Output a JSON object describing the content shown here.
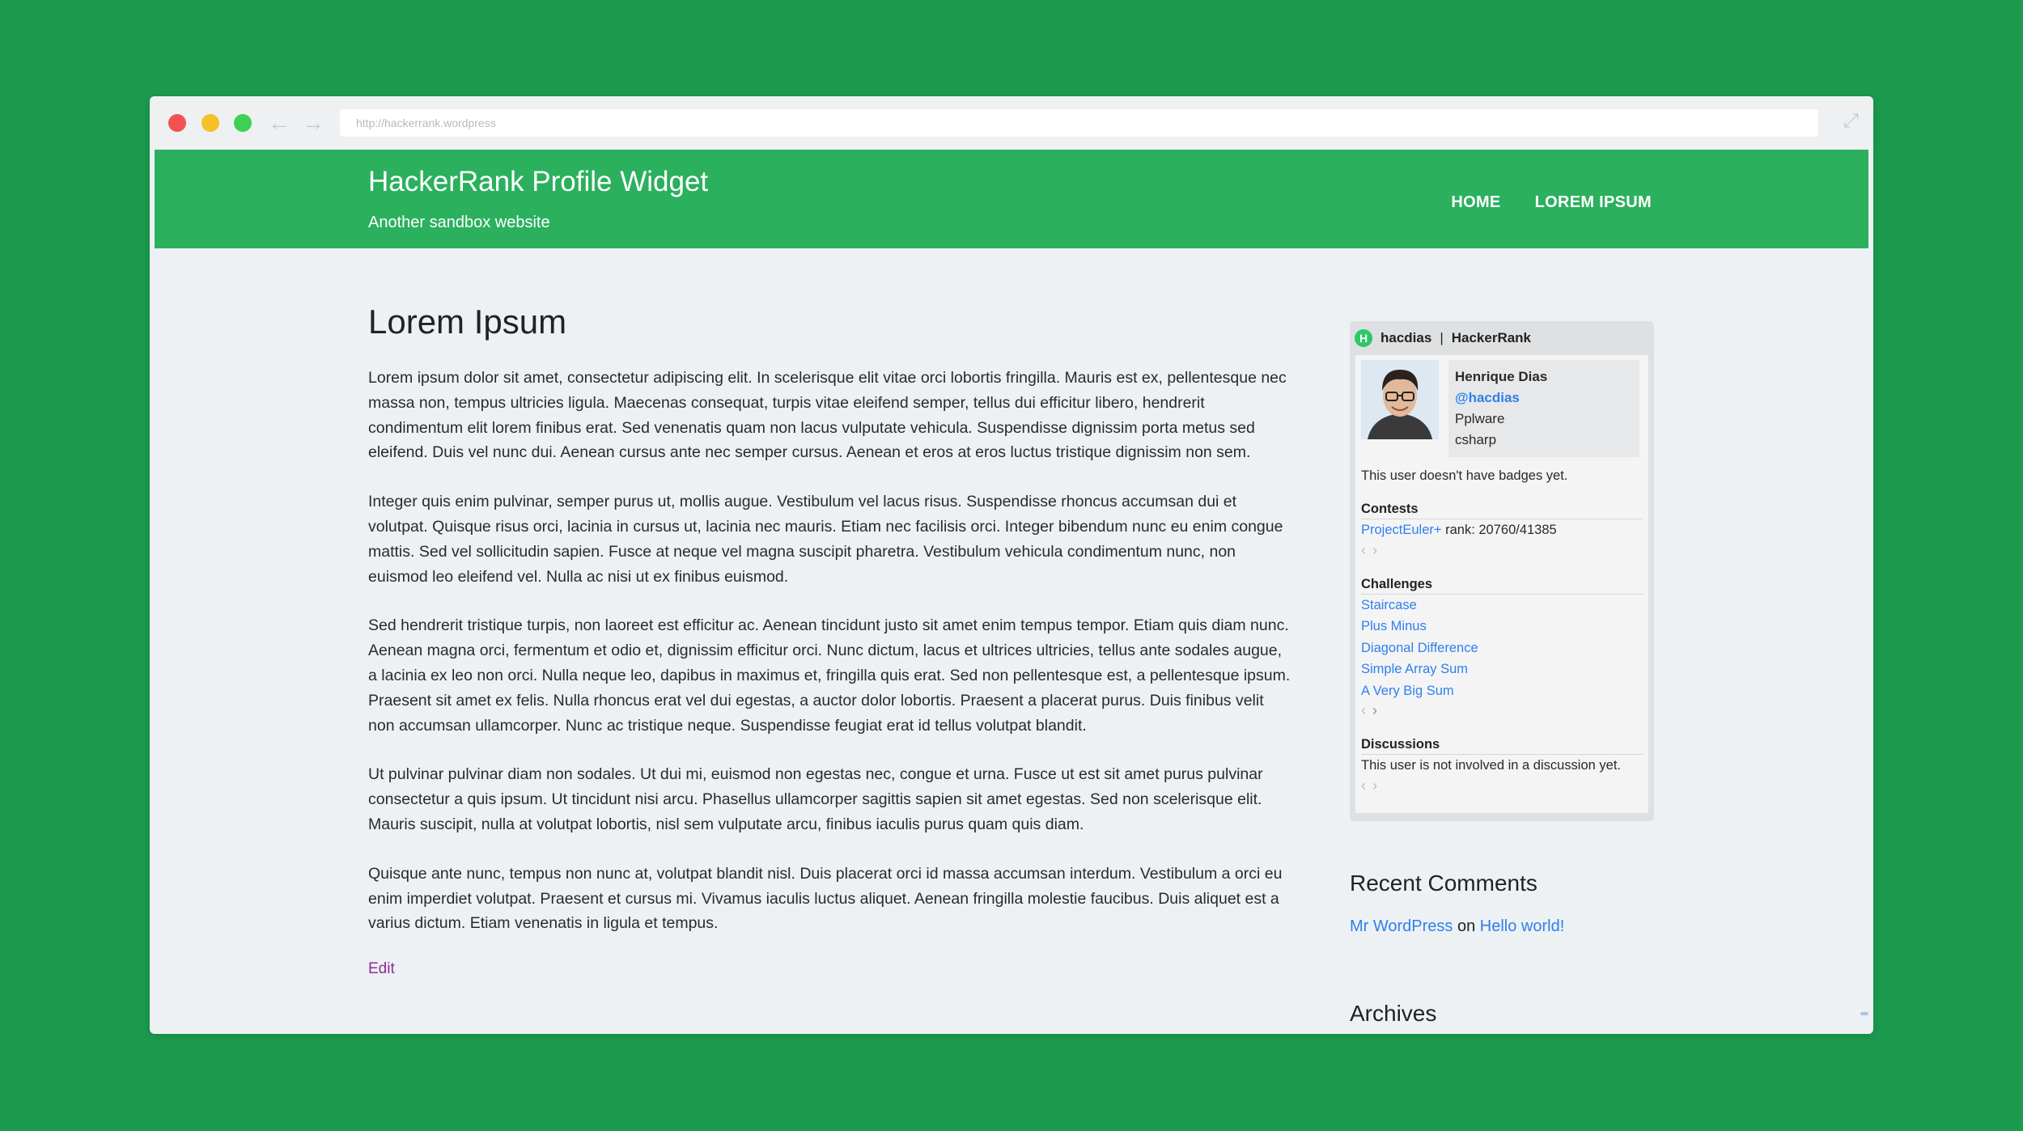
{
  "browser": {
    "url": "http://hackerrank.wordpress",
    "back_icon": "arrow-left-icon",
    "forward_icon": "arrow-right-icon",
    "expand_icon": "expand-icon",
    "traffic_lights": [
      "#f05252",
      "#f5c028",
      "#3ecf55"
    ]
  },
  "site": {
    "title": "HackerRank Profile Widget",
    "tagline": "Another sandbox website",
    "menu": [
      {
        "label": "HOME"
      },
      {
        "label": "LOREM IPSUM"
      }
    ],
    "accent": "#2bb05e"
  },
  "post": {
    "title": "Lorem Ipsum",
    "paragraphs": [
      "Lorem ipsum dolor sit amet, consectetur adipiscing elit. In scelerisque elit vitae orci lobortis fringilla. Mauris est ex, pellentesque nec massa non, tempus ultricies ligula. Maecenas consequat, turpis vitae eleifend semper, tellus dui efficitur libero, hendrerit condimentum elit lorem finibus erat. Sed venenatis quam non lacus vulputate vehicula. Suspendisse dignissim porta metus sed eleifend. Duis vel nunc dui. Aenean cursus ante nec semper cursus. Aenean et eros at eros luctus tristique dignissim non sem.",
      "Integer quis enim pulvinar, semper purus ut, mollis augue. Vestibulum vel lacus risus. Suspendisse rhoncus accumsan dui et volutpat. Quisque risus orci, lacinia in cursus ut, lacinia nec mauris. Etiam nec facilisis orci. Integer bibendum nunc eu enim congue mattis. Sed vel sollicitudin sapien. Fusce at neque vel magna suscipit pharetra. Vestibulum vehicula condimentum nunc, non euismod leo eleifend vel. Nulla ac nisi ut ex finibus euismod.",
      "Sed hendrerit tristique turpis, non laoreet est efficitur ac. Aenean tincidunt justo sit amet enim tempus tempor. Etiam quis diam nunc. Aenean magna orci, fermentum et odio et, dignissim efficitur orci. Nunc dictum, lacus et ultrices ultricies, tellus ante sodales augue, a lacinia ex leo non orci. Nulla neque leo, dapibus in maximus et, fringilla quis erat. Sed non pellentesque est, a pellentesque ipsum. Praesent sit amet ex felis. Nulla rhoncus erat vel dui egestas, a auctor dolor lobortis. Praesent a placerat purus. Duis finibus velit non accumsan ullamcorper. Nunc ac tristique neque. Suspendisse feugiat erat id tellus volutpat blandit.",
      "Ut pulvinar pulvinar diam non sodales. Ut dui mi, euismod non egestas nec, congue et urna. Fusce ut est sit amet purus pulvinar consectetur a quis ipsum. Ut tincidunt nisi arcu. Phasellus ullamcorper sagittis sapien sit amet egestas. Sed non scelerisque elit. Mauris suscipit, nulla at volutpat lobortis, nisl sem vulputate arcu, finibus iaculis purus quam quis diam.",
      "Quisque ante nunc, tempus non nunc at, volutpat blandit nisl. Duis placerat orci id massa accumsan interdum. Vestibulum a orci eu enim imperdiet volutpat. Praesent et cursus mi. Vivamus iaculis luctus aliquet. Aenean fringilla molestie faucibus. Duis aliquet est a varius dictum. Etiam venenatis in ligula et tempus."
    ],
    "edit_label": "Edit"
  },
  "widget": {
    "logo_letter": "H",
    "username": "hacdias",
    "separator": "|",
    "brand": "HackerRank",
    "profile": {
      "name": "Henrique Dias",
      "handle": "@hacdias",
      "company": "Pplware",
      "language": "csharp"
    },
    "badges_text": "This user doesn't have badges yet.",
    "contests": {
      "title": "Contests",
      "items": [
        {
          "name": "ProjectEuler+",
          "rank_text": " rank: 20760/41385"
        }
      ]
    },
    "challenges": {
      "title": "Challenges",
      "items": [
        "Staircase",
        "Plus Minus",
        "Diagonal Difference",
        "Simple Array Sum",
        "A Very Big Sum"
      ]
    },
    "discussions": {
      "title": "Discussions",
      "text": "This user is not involved in a discussion yet."
    },
    "pager_prev": "‹",
    "pager_next": "›"
  },
  "sidebar": {
    "recent_comments_title": "Recent Comments",
    "comment_author": "Mr WordPress",
    "comment_on": " on ",
    "comment_post": "Hello world!",
    "archives_title": "Archives"
  }
}
